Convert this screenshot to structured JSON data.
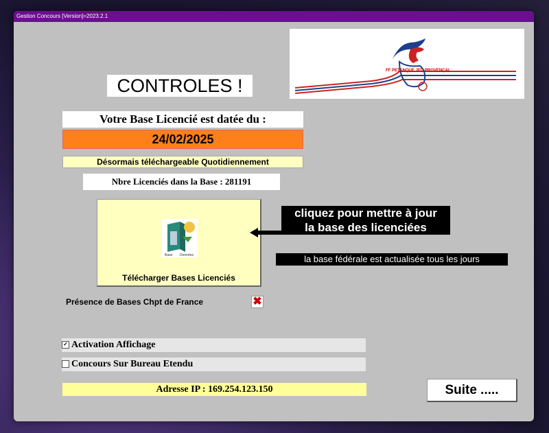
{
  "window": {
    "title": "Gestion Concours [Version]=2023.2.1"
  },
  "logo": {
    "text": "FF PETANQUE JEU PROVENÇAL"
  },
  "heading": "CONTROLES !",
  "base": {
    "date_label": "Votre Base Licencié est datée du :",
    "date_value": "24/02/2025",
    "daily_text": "Désormais téléchargeable Quotidiennement",
    "count_text": "Nbre Licenciés dans la Base : 281191"
  },
  "download": {
    "icon_caption_left": "Base",
    "icon_caption_right": "Données",
    "label": "Télécharger Bases Licenciés"
  },
  "tips": {
    "click_line1": "cliquez pour mettre à jour",
    "click_line2": "la base des licenciées",
    "daily_note": "la base fédérale est actualisée tous les jours"
  },
  "championship": {
    "label": "Présence de Bases Chpt de France",
    "status_symbol": "✖"
  },
  "options": [
    {
      "label": "Activation Affichage",
      "checked": true,
      "mark": "✓"
    },
    {
      "label": "Concours Sur Bureau Etendu",
      "checked": false,
      "mark": ""
    }
  ],
  "ip_text": "Adresse IP : 169.254.123.150",
  "suite_label": "Suite .....",
  "colors": {
    "titlebar": "#6a0f8e",
    "date_bg": "#ff7f1a",
    "yellow": "#ffffc0",
    "ip_bg": "#ffff99"
  }
}
